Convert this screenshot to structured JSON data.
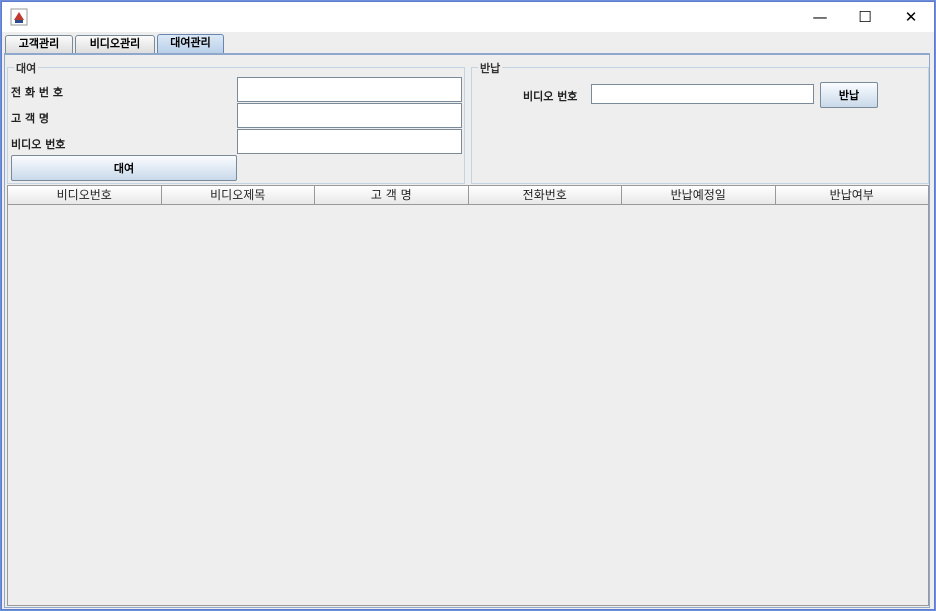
{
  "window": {
    "minimize_glyph": "—",
    "maximize_glyph": "☐",
    "close_glyph": "✕"
  },
  "tabs": [
    {
      "label": "고객관리",
      "active": false
    },
    {
      "label": "비디오관리",
      "active": false
    },
    {
      "label": "대여관리",
      "active": true
    }
  ],
  "rental": {
    "group_title": "대여",
    "phone_label": "전 화 번 호",
    "phone_value": "",
    "customer_label": "고  객  명",
    "customer_value": "",
    "video_label": "비디오 번호",
    "video_value": "",
    "rent_button": "대여"
  },
  "return": {
    "group_title": "반납",
    "video_label": "비디오 번호",
    "video_value": "",
    "return_button": "반납"
  },
  "table": {
    "columns": [
      "비디오번호",
      "비디오제목",
      "고 객 명",
      "전화번호",
      "반납예정일",
      "반납여부"
    ],
    "rows": []
  },
  "icons": {
    "app": "java-cup-icon"
  }
}
